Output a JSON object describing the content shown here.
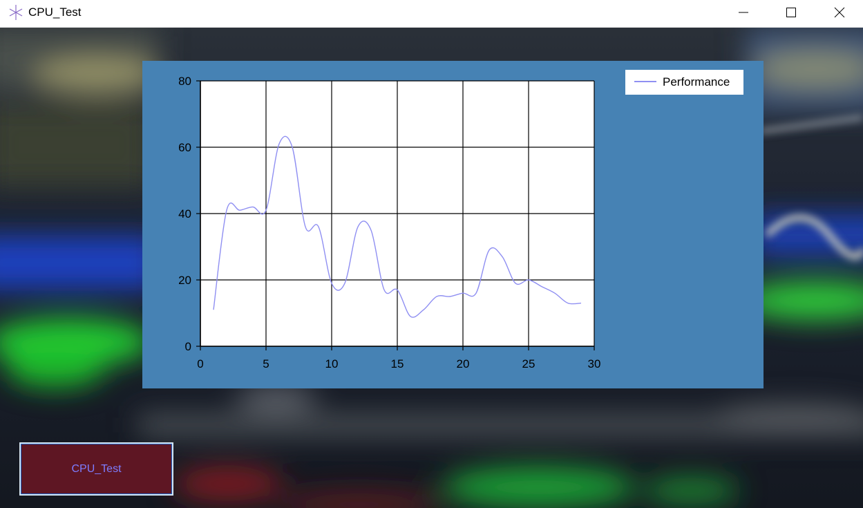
{
  "window": {
    "title": "CPU_Test",
    "icons": {
      "app": "asterisk-icon",
      "minimize": "minimize-icon",
      "maximize": "maximize-icon",
      "close": "close-icon"
    }
  },
  "legend": {
    "label": "Performance"
  },
  "button": {
    "label": "CPU_Test"
  },
  "colors": {
    "panel": "#4682b4",
    "plot_bg": "#ffffff",
    "series": "#8f8ff2",
    "button_bg": "#5e1623",
    "button_text": "#7d7dff"
  },
  "chart_data": {
    "type": "line",
    "title": "",
    "xlabel": "",
    "ylabel": "",
    "xlim": [
      0,
      30
    ],
    "ylim": [
      0,
      80
    ],
    "x_ticks": [
      0,
      5,
      10,
      15,
      20,
      25,
      30
    ],
    "y_ticks": [
      0,
      20,
      40,
      60,
      80
    ],
    "grid": true,
    "legend_position": "top-right",
    "smooth": true,
    "series": [
      {
        "name": "Performance",
        "x": [
          1,
          2,
          3,
          4,
          5,
          6,
          7,
          8,
          9,
          10,
          11,
          12,
          13,
          14,
          15,
          16,
          17,
          18,
          19,
          20,
          21,
          22,
          23,
          24,
          25,
          26,
          27,
          28,
          29
        ],
        "values": [
          11,
          41,
          41,
          42,
          41,
          61,
          60,
          36,
          36,
          19,
          19,
          36,
          35,
          17,
          17,
          9,
          11,
          15,
          15,
          16,
          16,
          29,
          27,
          19,
          20,
          18,
          16,
          13,
          13
        ]
      }
    ]
  }
}
